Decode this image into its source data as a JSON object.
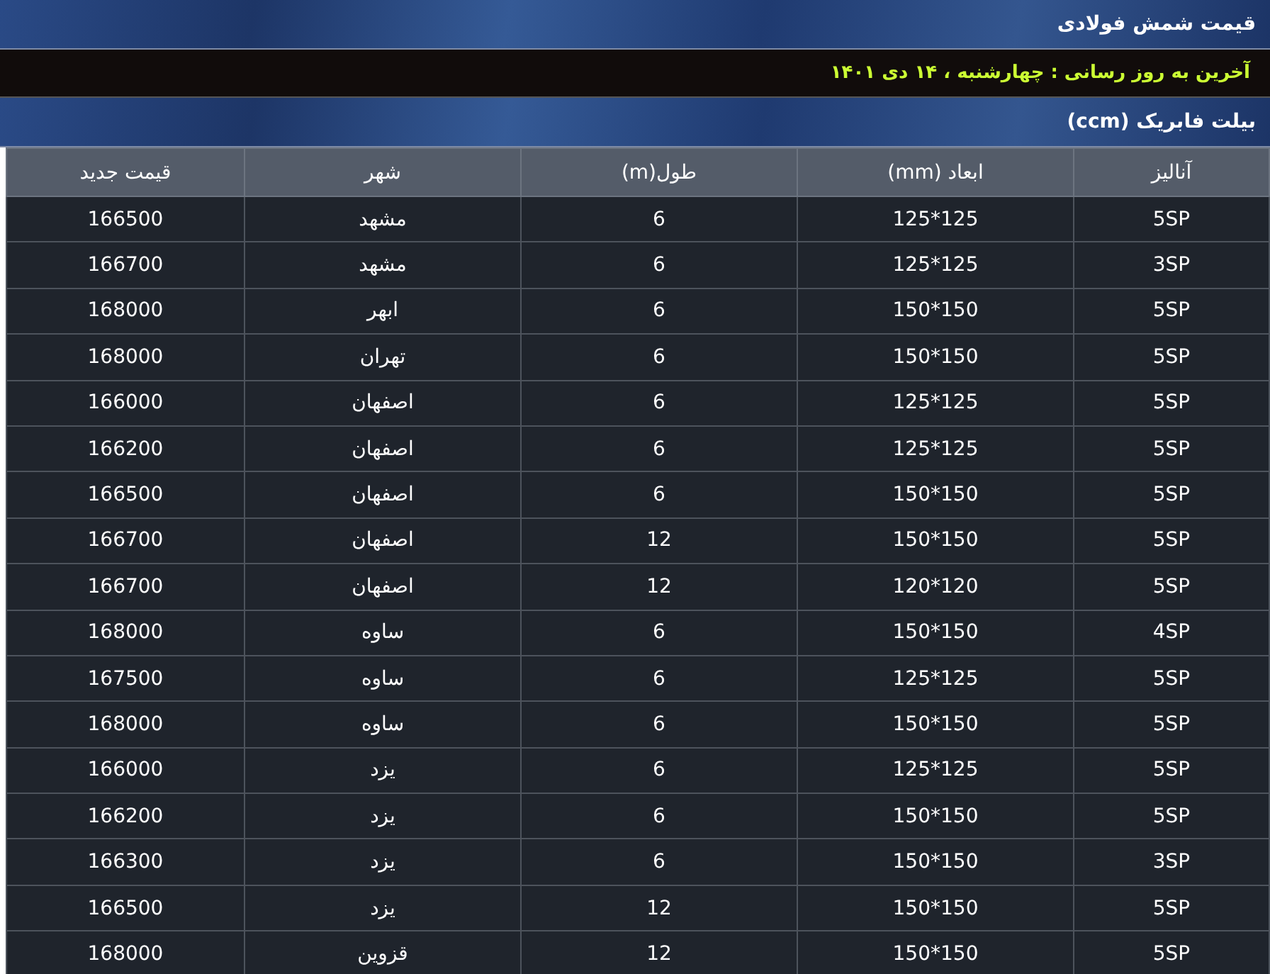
{
  "title": "قیمت شمش فولادی",
  "last_update": "آخرین به روز رسانی : چهارشنبه ، ۱۴ دی ۱۴۰۱",
  "section_title": "بیلت فابریک (ccm)",
  "table": {
    "columns": [
      "آنالیز",
      "ابعاد (mm)",
      "طول(m)",
      "شهر",
      "قیمت جدید"
    ],
    "rows": [
      [
        "5SP",
        "125*125",
        "6",
        "مشهد",
        "166500"
      ],
      [
        "3SP",
        "125*125",
        "6",
        "مشهد",
        "166700"
      ],
      [
        "5SP",
        "150*150",
        "6",
        "ابهر",
        "168000"
      ],
      [
        "5SP",
        "150*150",
        "6",
        "تهران",
        "168000"
      ],
      [
        "5SP",
        "125*125",
        "6",
        "اصفهان",
        "166000"
      ],
      [
        "5SP",
        "125*125",
        "6",
        "اصفهان",
        "166200"
      ],
      [
        "5SP",
        "150*150",
        "6",
        "اصفهان",
        "166500"
      ],
      [
        "5SP",
        "150*150",
        "12",
        "اصفهان",
        "166700"
      ],
      [
        "5SP",
        "120*120",
        "12",
        "اصفهان",
        "166700"
      ],
      [
        "4SP",
        "150*150",
        "6",
        "ساوه",
        "168000"
      ],
      [
        "5SP",
        "125*125",
        "6",
        "ساوه",
        "167500"
      ],
      [
        "5SP",
        "150*150",
        "6",
        "ساوه",
        "168000"
      ],
      [
        "5SP",
        "125*125",
        "6",
        "یزد",
        "166000"
      ],
      [
        "5SP",
        "150*150",
        "6",
        "یزد",
        "166200"
      ],
      [
        "3SP",
        "150*150",
        "6",
        "یزد",
        "166300"
      ],
      [
        "5SP",
        "150*150",
        "12",
        "یزد",
        "166500"
      ],
      [
        "5SP",
        "150*150",
        "12",
        "قزوین",
        "168000"
      ]
    ]
  }
}
